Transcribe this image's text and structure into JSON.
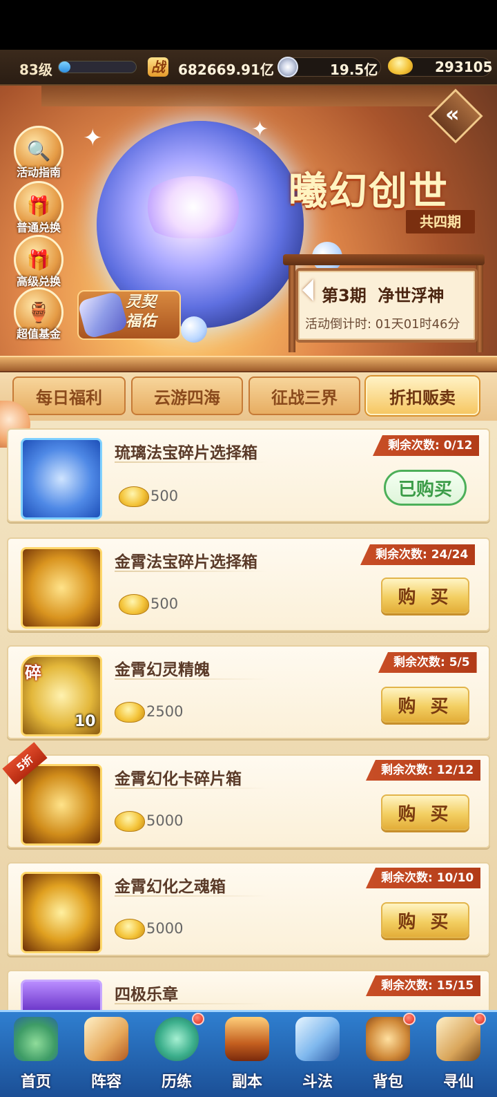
{
  "status": {
    "level": "83级",
    "level_progress": 0.15,
    "power_icon": "战",
    "power": "682669.91亿",
    "silver": "19.5亿",
    "gold": "293105"
  },
  "banner": {
    "title": "曦幻创世",
    "periods": "共四期",
    "current_period": "第3期  净世浮神",
    "countdown": "活动倒计时: 01天01时46分",
    "blessing": "灵契\n福佑",
    "side_buttons": [
      {
        "label": "活动指南",
        "icon": "magnifier-icon"
      },
      {
        "label": "普通兑换",
        "icon": "gift-box-icon"
      },
      {
        "label": "高级兑换",
        "icon": "gift-box-icon"
      },
      {
        "label": "超值基金",
        "icon": "treasure-pot-icon"
      }
    ]
  },
  "tabs": [
    {
      "label": "每日福利",
      "active": false
    },
    {
      "label": "云游四海",
      "active": false
    },
    {
      "label": "征战三界",
      "active": false
    },
    {
      "label": "折扣贩卖",
      "active": true
    }
  ],
  "items": [
    {
      "name": "琉璃法宝碎片选择箱",
      "price": "500",
      "remaining": "剩余次数: 0/12",
      "button": "已购买",
      "bought": true
    },
    {
      "name": "金霄法宝碎片选择箱",
      "price": "500",
      "remaining": "剩余次数: 24/24",
      "button": "购 买",
      "bought": false
    },
    {
      "name": "金霄幻灵精魄",
      "price": "2500",
      "remaining": "剩余次数: 5/5",
      "button": "购 买",
      "bought": false,
      "badge": "碎",
      "qty": "10"
    },
    {
      "name": "金霄幻化卡碎片箱",
      "price": "5000",
      "remaining": "剩余次数: 12/12",
      "button": "购 买",
      "bought": false,
      "discount": "5折"
    },
    {
      "name": "金霄幻化之魂箱",
      "price": "5000",
      "remaining": "剩余次数: 10/10",
      "button": "购 买",
      "bought": false
    },
    {
      "name": "四极乐章",
      "price": "",
      "remaining": "剩余次数: 15/15",
      "button": "",
      "bought": false
    }
  ],
  "nav": [
    {
      "label": "首页",
      "icon": "home-island-icon"
    },
    {
      "label": "阵容",
      "icon": "lineup-cards-icon"
    },
    {
      "label": "历练",
      "icon": "training-gourd-icon"
    },
    {
      "label": "副本",
      "icon": "dungeon-gate-icon"
    },
    {
      "label": "斗法",
      "icon": "battle-sword-icon"
    },
    {
      "label": "背包",
      "icon": "backpack-icon"
    },
    {
      "label": "寻仙",
      "icon": "scroll-icon"
    }
  ],
  "colors": {
    "accent_red": "#c84e26",
    "gold": "#f3cf62",
    "bought_green": "#4caf59",
    "nav_blue": "#2f7fd0"
  }
}
